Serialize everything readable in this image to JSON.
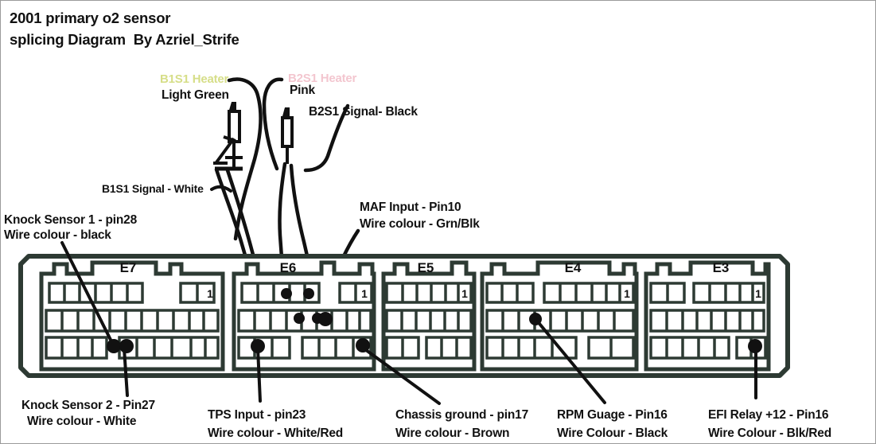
{
  "title": {
    "line1": "2001 primary o2 sensor",
    "line2": "splicing Diagram  By Azriel_Strife"
  },
  "colors": {
    "outline": "#2d3a33",
    "wire": "#111111",
    "heater_b1s1": "#d6de88",
    "heater_b2s1": "#f3c6cf",
    "background": "#ffffff",
    "frame": "#9a9a9a"
  },
  "sensor_labels": {
    "b1s1_heater": "B1S1 Heater",
    "b1s1_heater_colour": "Light Green",
    "b2s1_heater": "B2S1 Heater",
    "b2s1_heater_colour": "Pink",
    "b2s1_signal": "B2S1 Signal- Black",
    "b1s1_signal": "B1S1 Signal - White"
  },
  "callouts": {
    "maf": {
      "line1": "MAF Input - Pin10",
      "line2": "Wire colour - Grn/Blk"
    },
    "knock1": {
      "line1": "Knock Sensor 1 - pin28",
      "line2": "Wire colour - black"
    },
    "knock2": {
      "line1": "Knock Sensor 2 - Pin27",
      "line2": "Wire colour - White"
    },
    "tps": {
      "line1": "TPS Input - pin23",
      "line2": "Wire colour - White/Red"
    },
    "chassis": {
      "line1": "Chassis ground - pin17",
      "line2": "Wire colour - Brown"
    },
    "rpm": {
      "line1": "RPM Guage - Pin16",
      "line2": "Wire Colour - Black"
    },
    "efi": {
      "line1": "EFI Relay +12 - Pin16",
      "line2": "Wire Colour - Blk/Red"
    }
  },
  "connectors": [
    {
      "id": "E7",
      "label": "E7",
      "pin_one_label": "1"
    },
    {
      "id": "E6",
      "label": "E6",
      "pin_one_label": "1"
    },
    {
      "id": "E5",
      "label": "E5",
      "pin_one_label": "1"
    },
    {
      "id": "E4",
      "label": "E4",
      "pin_one_label": "1"
    },
    {
      "id": "E3",
      "label": "E3",
      "pin_one_label": "1"
    }
  ]
}
